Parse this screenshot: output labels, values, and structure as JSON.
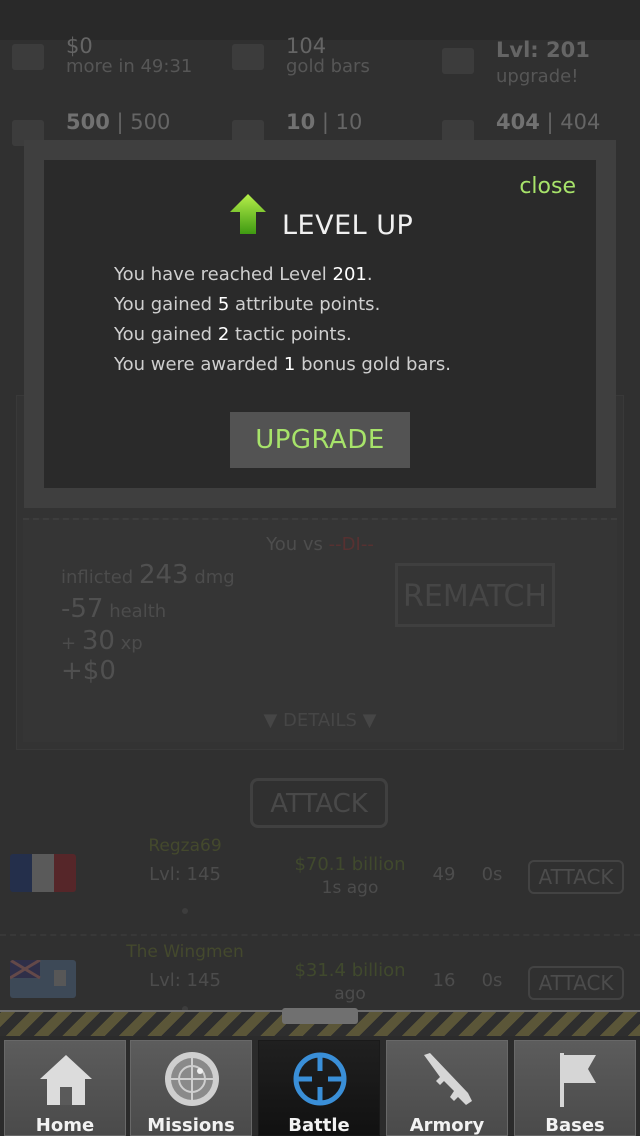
{
  "stats": {
    "money": {
      "value": "$0",
      "sub": "more in 49:31"
    },
    "gold": {
      "value": "104",
      "sub": "gold bars"
    },
    "level": {
      "value": "Lvl: 201",
      "sub": "upgrade!"
    },
    "energy": {
      "current": "500",
      "max": "500"
    },
    "stamina": {
      "current": "10",
      "max": "10"
    },
    "health": {
      "current": "404",
      "max": "404"
    }
  },
  "battle_result": {
    "vs_prefix": "You vs",
    "opponent": "--DI--",
    "inflicted_prefix": "inflicted",
    "inflicted_value": "243",
    "inflicted_suffix": "dmg",
    "health_change": "-57",
    "health_label": "health",
    "xp_prefix": "+",
    "xp_value": "30",
    "xp_label": "xp",
    "money_change": "+$0",
    "rematch_label": "REMATCH",
    "details_label": "▼ DETAILS ▼"
  },
  "attack_label": "ATTACK",
  "players": [
    {
      "name": "Regza69",
      "level": "Lvl: 145",
      "money": "$70.1 billion",
      "ago": "1s ago",
      "count": "49",
      "time": "0s",
      "attack": "ATTACK",
      "flag": "france"
    },
    {
      "name": "The Wingmen",
      "level": "Lvl: 145",
      "money": "$31.4 billion",
      "ago": "ago",
      "count": "16",
      "time": "0s",
      "attack": "ATTACK",
      "flag": "fiji"
    }
  ],
  "modal": {
    "close": "close",
    "title": "LEVEL UP",
    "line1_a": "You have reached Level",
    "line1_v": "201",
    "line1_b": ".",
    "line2_a": "You gained",
    "line2_v": "5",
    "line2_b": "attribute points.",
    "line3_a": "You gained",
    "line3_v": "2",
    "line3_b": "tactic points.",
    "line4_a": "You were awarded",
    "line4_v": "1",
    "line4_b": "bonus gold bars.",
    "upgrade": "UPGRADE",
    "accent": "#a7e36a"
  },
  "tabs": [
    {
      "label": "Home",
      "icon": "house-icon"
    },
    {
      "label": "Missions",
      "icon": "radar-icon"
    },
    {
      "label": "Battle",
      "icon": "crosshair-icon",
      "active": true
    },
    {
      "label": "Armory",
      "icon": "rifle-icon"
    },
    {
      "label": "Bases",
      "icon": "flag-icon"
    }
  ]
}
